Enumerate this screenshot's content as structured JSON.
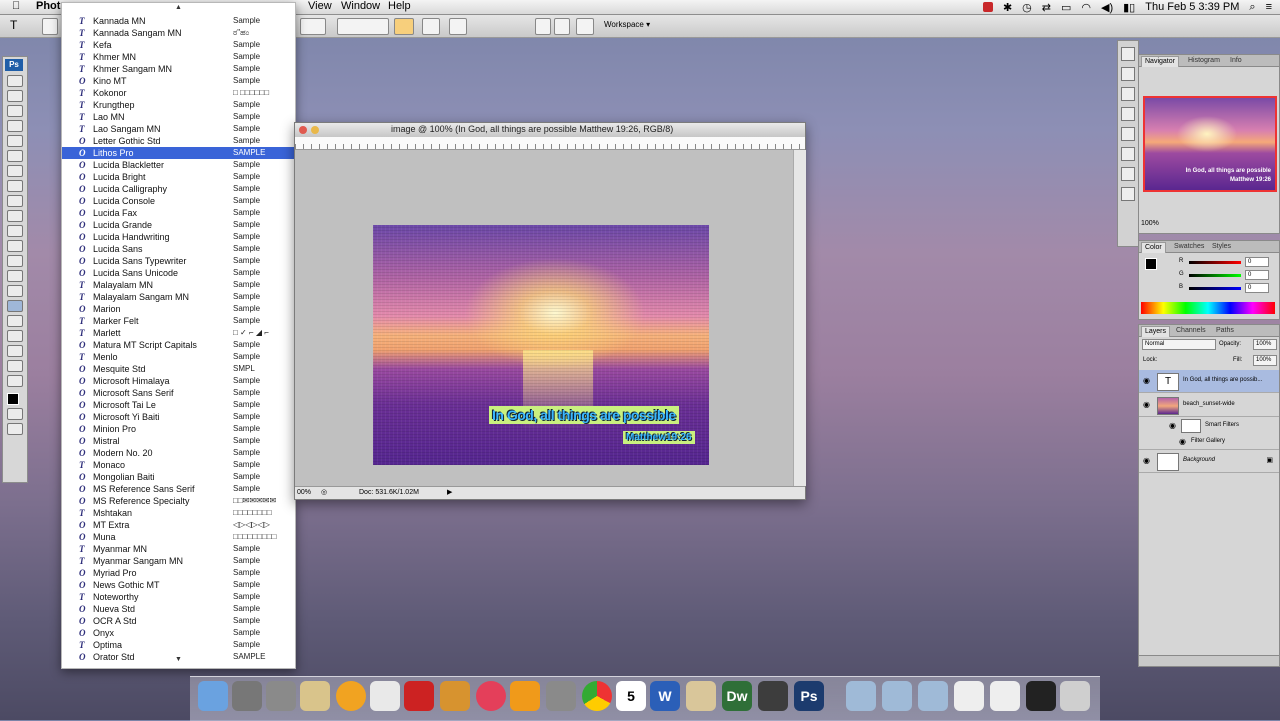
{
  "menubar": {
    "app_name": "Photo",
    "items": [
      "View",
      "Window",
      "Help"
    ],
    "clock": "Thu Feb 5  3:39 PM"
  },
  "options_bar": {
    "workspace_label": "Workspace ▾"
  },
  "font_menu": {
    "selected": "Lithos Pro",
    "fonts": [
      {
        "name": "Kannada MN",
        "sample": "Sample"
      },
      {
        "name": "Kannada Sangam MN",
        "sample": "ಠ\"ಹಂ"
      },
      {
        "name": "Kefa",
        "sample": "Sample"
      },
      {
        "name": "Khmer MN",
        "sample": "Sample"
      },
      {
        "name": "Khmer Sangam MN",
        "sample": "Sample"
      },
      {
        "name": "Kino MT",
        "sample": "Sample"
      },
      {
        "name": "Kokonor",
        "sample": "□ □□□□□□"
      },
      {
        "name": "Krungthep",
        "sample": "Sample"
      },
      {
        "name": "Lao MN",
        "sample": "Sample"
      },
      {
        "name": "Lao Sangam MN",
        "sample": "Sample"
      },
      {
        "name": "Letter Gothic Std",
        "sample": "Sample"
      },
      {
        "name": "Lithos Pro",
        "sample": "SAMPLE"
      },
      {
        "name": "Lucida Blackletter",
        "sample": "Sample"
      },
      {
        "name": "Lucida Bright",
        "sample": "Sample"
      },
      {
        "name": "Lucida Calligraphy",
        "sample": "Sample"
      },
      {
        "name": "Lucida Console",
        "sample": "Sample"
      },
      {
        "name": "Lucida Fax",
        "sample": "Sample"
      },
      {
        "name": "Lucida Grande",
        "sample": "Sample"
      },
      {
        "name": "Lucida Handwriting",
        "sample": "Sample"
      },
      {
        "name": "Lucida Sans",
        "sample": "Sample"
      },
      {
        "name": "Lucida Sans Typewriter",
        "sample": "Sample"
      },
      {
        "name": "Lucida Sans Unicode",
        "sample": "Sample"
      },
      {
        "name": "Malayalam MN",
        "sample": "Sample"
      },
      {
        "name": "Malayalam Sangam MN",
        "sample": "Sample"
      },
      {
        "name": "Marion",
        "sample": "Sample"
      },
      {
        "name": "Marker Felt",
        "sample": "Sample"
      },
      {
        "name": "Marlett",
        "sample": "□ ✓ ⌐ ◢ ⌐"
      },
      {
        "name": "Matura MT Script Capitals",
        "sample": "Sample"
      },
      {
        "name": "Menlo",
        "sample": "Sample"
      },
      {
        "name": "Mesquite Std",
        "sample": "SMPL"
      },
      {
        "name": "Microsoft Himalaya",
        "sample": "Sample"
      },
      {
        "name": "Microsoft Sans Serif",
        "sample": "Sample"
      },
      {
        "name": "Microsoft Tai Le",
        "sample": "Sample"
      },
      {
        "name": "Microsoft Yi Baiti",
        "sample": "Sample"
      },
      {
        "name": "Minion Pro",
        "sample": "Sample"
      },
      {
        "name": "Mistral",
        "sample": "Sample"
      },
      {
        "name": "Modern No. 20",
        "sample": "Sample"
      },
      {
        "name": "Monaco",
        "sample": "Sample"
      },
      {
        "name": "Mongolian Baiti",
        "sample": "Sample"
      },
      {
        "name": "MS Reference Sans Serif",
        "sample": "Sample"
      },
      {
        "name": "MS Reference Specialty",
        "sample": "□□✉✉✉✉✉"
      },
      {
        "name": "Mshtakan",
        "sample": "□□□□□□□□"
      },
      {
        "name": "MT Extra",
        "sample": "◁▷◁▷◁▷"
      },
      {
        "name": "Muna",
        "sample": "□□□□□□□□□"
      },
      {
        "name": "Myanmar MN",
        "sample": "Sample"
      },
      {
        "name": "Myanmar Sangam MN",
        "sample": "Sample"
      },
      {
        "name": "Myriad Pro",
        "sample": "Sample"
      },
      {
        "name": "News Gothic MT",
        "sample": "Sample"
      },
      {
        "name": "Noteworthy",
        "sample": "Sample"
      },
      {
        "name": "Nueva Std",
        "sample": "Sample"
      },
      {
        "name": "OCR A Std",
        "sample": "Sample"
      },
      {
        "name": "Onyx",
        "sample": "Sample"
      },
      {
        "name": "Optima",
        "sample": "Sample"
      },
      {
        "name": "Orator Std",
        "sample": "SAMPLE"
      }
    ]
  },
  "document": {
    "title": "image @ 100% (In God, all things are possible Matthew 19:26, RGB/8)",
    "zoom_status": "00%",
    "doc_size": "Doc: 531.6K/1.02M",
    "caption_line1": "In God, all things are possible",
    "caption_line2": "Matthew19:26"
  },
  "navigator": {
    "tabs": [
      "Navigator",
      "Histogram",
      "Info"
    ],
    "zoom": "100%",
    "thumb_line1": "In God, all things are possible",
    "thumb_line2": "Matthew 19:26"
  },
  "color_panel": {
    "tabs": [
      "Color",
      "Swatches",
      "Styles"
    ],
    "channels": [
      {
        "label": "R",
        "value": "0"
      },
      {
        "label": "G",
        "value": "0"
      },
      {
        "label": "B",
        "value": "0"
      }
    ]
  },
  "layers_panel": {
    "tabs": [
      "Layers",
      "Channels",
      "Paths"
    ],
    "blend_mode": "Normal",
    "opacity_label": "Opacity:",
    "opacity": "100%",
    "lock_label": "Lock:",
    "fill_label": "Fill:",
    "fill": "100%",
    "layers": [
      {
        "name": "In God, all things are possib...",
        "thumb": "T"
      },
      {
        "name": "beach_sunset-wide",
        "thumb": ""
      },
      {
        "name": "Smart Filters",
        "thumb": ""
      },
      {
        "name": "Filter Gallery",
        "thumb": ""
      },
      {
        "name": "Background",
        "thumb": ""
      }
    ]
  },
  "dock": {
    "apps": [
      "Finder",
      "Launchpad",
      "Mail",
      "Address Book",
      "Opera",
      "TextEdit",
      "Notes",
      "Photo",
      "iTunes",
      "iBooks",
      "System Preferences",
      "Chrome",
      "Calendar",
      "Word",
      "Preview",
      "Dw",
      "Terminal",
      "Ps"
    ],
    "calendar_day": "5",
    "dw_label": "Dw",
    "ps_label": "Ps",
    "word_label": "W"
  },
  "colors": {
    "selection_blue": "#3a64d8",
    "caption_bg": "#c9f07f",
    "caption_text": "#3ab8ff"
  }
}
